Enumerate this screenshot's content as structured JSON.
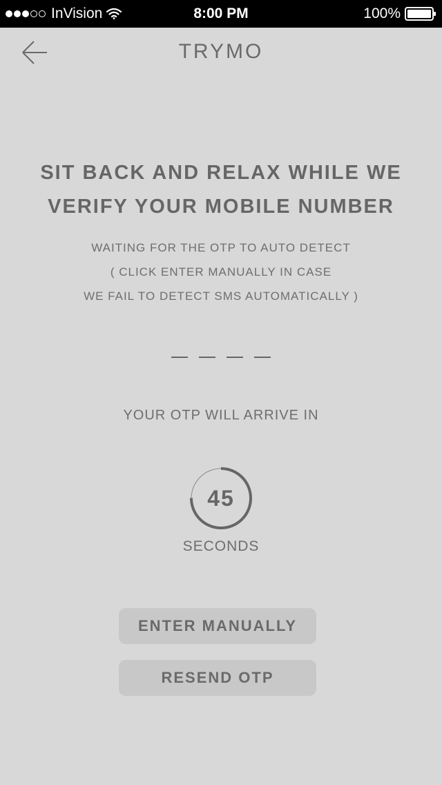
{
  "status_bar": {
    "carrier": "InVision",
    "time": "8:00 PM",
    "battery": "100%",
    "signal_filled": 3,
    "signal_total": 5
  },
  "nav": {
    "back_icon": "arrow-left-icon",
    "title": "TRYMO"
  },
  "headline": {
    "line1": "SIT BACK AND RELAX WHILE WE",
    "line2": "VERIFY YOUR MOBILE NUMBER"
  },
  "instructions": {
    "line1": "WAITING FOR THE OTP TO AUTO DETECT",
    "line2": "( CLICK ENTER MANUALLY IN CASE",
    "line3": "WE FAIL TO DETECT SMS AUTOMATICALLY )"
  },
  "otp": {
    "digits": [
      "",
      "",
      "",
      ""
    ],
    "arrive_label": "YOUR OTP WILL ARRIVE IN"
  },
  "countdown": {
    "value": "45",
    "unit": "SECONDS",
    "remaining_fraction": 0.75
  },
  "buttons": {
    "enter_manually": "ENTER MANUALLY",
    "resend_otp": "RESEND OTP"
  },
  "colors": {
    "background": "#d8d8d8",
    "text": "#666666",
    "button_bg": "#c8c8c8",
    "status_bar": "#000000"
  }
}
